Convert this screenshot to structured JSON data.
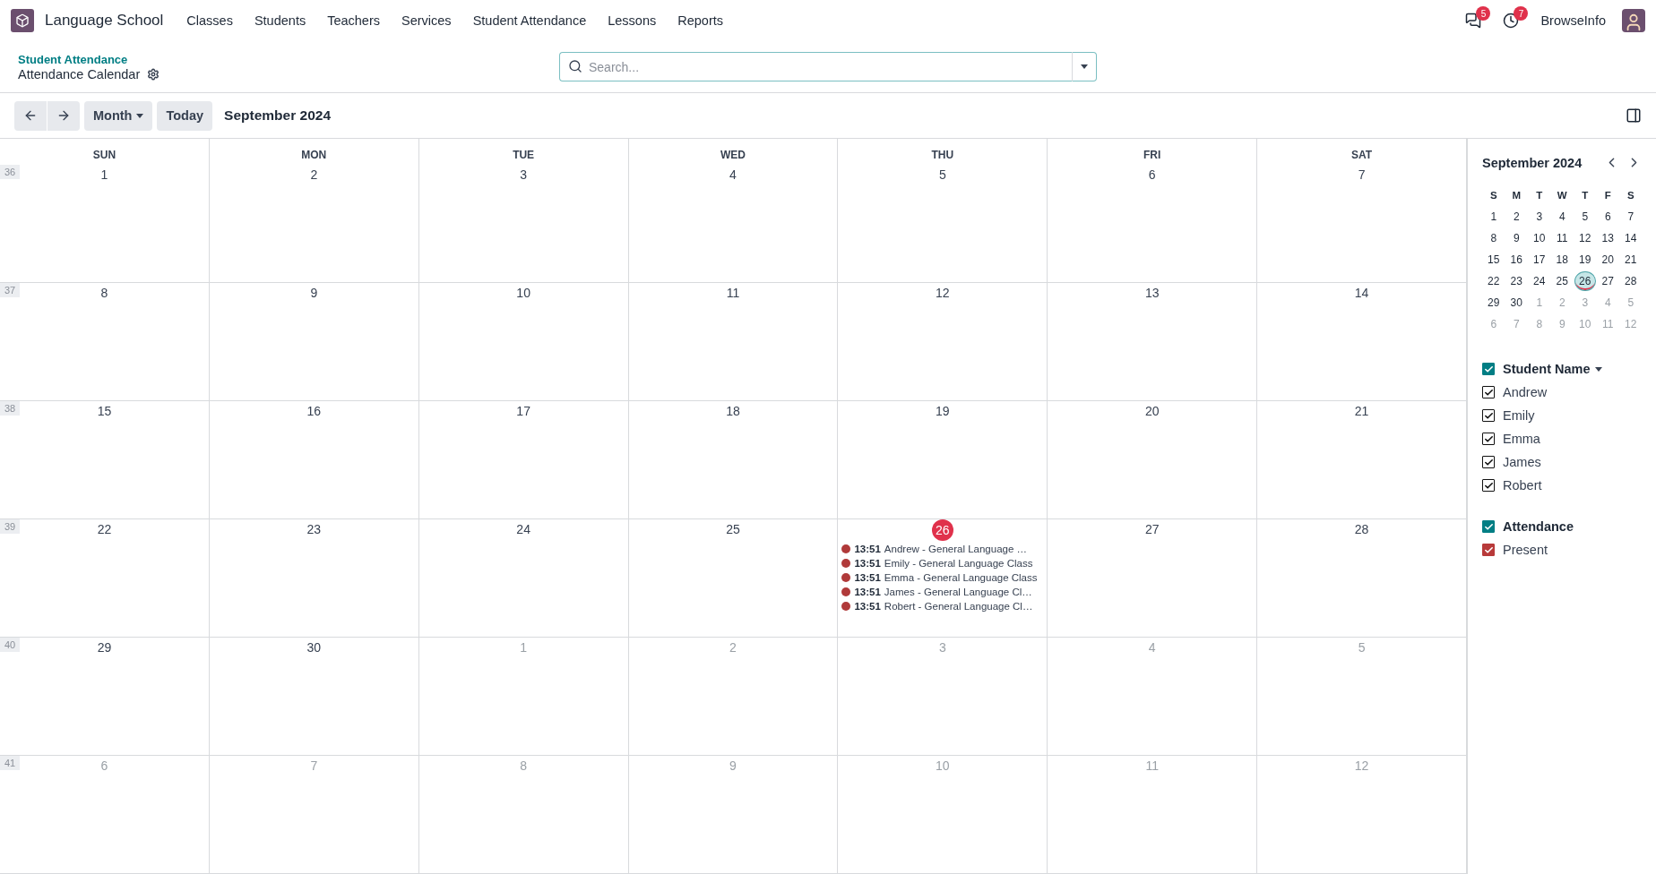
{
  "navbar": {
    "app_name": "Language School",
    "menu": [
      "Classes",
      "Students",
      "Teachers",
      "Services",
      "Student Attendance",
      "Lessons",
      "Reports"
    ],
    "messages_badge": "5",
    "activities_badge": "7",
    "user": "BrowseInfo"
  },
  "breadcrumb": {
    "parent": "Student Attendance",
    "current": "Attendance Calendar"
  },
  "search": {
    "placeholder": "Search..."
  },
  "toolbar": {
    "scale": "Month",
    "today": "Today",
    "period": "September 2024"
  },
  "calendar": {
    "weekdays": [
      "SUN",
      "MON",
      "TUE",
      "WED",
      "THU",
      "FRI",
      "SAT"
    ],
    "weeks": [
      {
        "number": "36",
        "days": [
          {
            "day": "1",
            "other_month": false,
            "today": false
          },
          {
            "day": "2",
            "other_month": false,
            "today": false
          },
          {
            "day": "3",
            "other_month": false,
            "today": false
          },
          {
            "day": "4",
            "other_month": false,
            "today": false
          },
          {
            "day": "5",
            "other_month": false,
            "today": false
          },
          {
            "day": "6",
            "other_month": false,
            "today": false
          },
          {
            "day": "7",
            "other_month": false,
            "today": false
          }
        ]
      },
      {
        "number": "37",
        "days": [
          {
            "day": "8",
            "other_month": false,
            "today": false
          },
          {
            "day": "9",
            "other_month": false,
            "today": false
          },
          {
            "day": "10",
            "other_month": false,
            "today": false
          },
          {
            "day": "11",
            "other_month": false,
            "today": false
          },
          {
            "day": "12",
            "other_month": false,
            "today": false
          },
          {
            "day": "13",
            "other_month": false,
            "today": false
          },
          {
            "day": "14",
            "other_month": false,
            "today": false
          }
        ]
      },
      {
        "number": "38",
        "days": [
          {
            "day": "15",
            "other_month": false,
            "today": false
          },
          {
            "day": "16",
            "other_month": false,
            "today": false
          },
          {
            "day": "17",
            "other_month": false,
            "today": false
          },
          {
            "day": "18",
            "other_month": false,
            "today": false
          },
          {
            "day": "19",
            "other_month": false,
            "today": false
          },
          {
            "day": "20",
            "other_month": false,
            "today": false
          },
          {
            "day": "21",
            "other_month": false,
            "today": false
          }
        ]
      },
      {
        "number": "39",
        "days": [
          {
            "day": "22",
            "other_month": false,
            "today": false
          },
          {
            "day": "23",
            "other_month": false,
            "today": false
          },
          {
            "day": "24",
            "other_month": false,
            "today": false
          },
          {
            "day": "25",
            "other_month": false,
            "today": false
          },
          {
            "day": "26",
            "other_month": false,
            "today": true,
            "events": [
              {
                "time": "13:51",
                "title": "Andrew - General Language …"
              },
              {
                "time": "13:51",
                "title": "Emily - General Language Class"
              },
              {
                "time": "13:51",
                "title": "Emma - General Language Class"
              },
              {
                "time": "13:51",
                "title": "James - General Language Cl…"
              },
              {
                "time": "13:51",
                "title": "Robert - General Language Cl…"
              }
            ]
          },
          {
            "day": "27",
            "other_month": false,
            "today": false
          },
          {
            "day": "28",
            "other_month": false,
            "today": false
          }
        ]
      },
      {
        "number": "40",
        "days": [
          {
            "day": "29",
            "other_month": false,
            "today": false
          },
          {
            "day": "30",
            "other_month": false,
            "today": false
          },
          {
            "day": "1",
            "other_month": true,
            "today": false
          },
          {
            "day": "2",
            "other_month": true,
            "today": false
          },
          {
            "day": "3",
            "other_month": true,
            "today": false
          },
          {
            "day": "4",
            "other_month": true,
            "today": false
          },
          {
            "day": "5",
            "other_month": true,
            "today": false
          }
        ]
      },
      {
        "number": "41",
        "days": [
          {
            "day": "6",
            "other_month": true,
            "today": false
          },
          {
            "day": "7",
            "other_month": true,
            "today": false
          },
          {
            "day": "8",
            "other_month": true,
            "today": false
          },
          {
            "day": "9",
            "other_month": true,
            "today": false
          },
          {
            "day": "10",
            "other_month": true,
            "today": false
          },
          {
            "day": "11",
            "other_month": true,
            "today": false
          },
          {
            "day": "12",
            "other_month": true,
            "today": false
          }
        ]
      }
    ]
  },
  "mini_calendar": {
    "title": "September 2024",
    "weekdays": [
      "S",
      "M",
      "T",
      "W",
      "T",
      "F",
      "S"
    ],
    "weeks": [
      [
        {
          "day": "1",
          "other_month": false,
          "today": false,
          "has_events": false
        },
        {
          "day": "2",
          "other_month": false,
          "today": false,
          "has_events": false
        },
        {
          "day": "3",
          "other_month": false,
          "today": false,
          "has_events": false
        },
        {
          "day": "4",
          "other_month": false,
          "today": false,
          "has_events": false
        },
        {
          "day": "5",
          "other_month": false,
          "today": false,
          "has_events": false
        },
        {
          "day": "6",
          "other_month": false,
          "today": false,
          "has_events": false
        },
        {
          "day": "7",
          "other_month": false,
          "today": false,
          "has_events": false
        }
      ],
      [
        {
          "day": "8",
          "other_month": false,
          "today": false,
          "has_events": false
        },
        {
          "day": "9",
          "other_month": false,
          "today": false,
          "has_events": false
        },
        {
          "day": "10",
          "other_month": false,
          "today": false,
          "has_events": false
        },
        {
          "day": "11",
          "other_month": false,
          "today": false,
          "has_events": false
        },
        {
          "day": "12",
          "other_month": false,
          "today": false,
          "has_events": false
        },
        {
          "day": "13",
          "other_month": false,
          "today": false,
          "has_events": false
        },
        {
          "day": "14",
          "other_month": false,
          "today": false,
          "has_events": false
        }
      ],
      [
        {
          "day": "15",
          "other_month": false,
          "today": false,
          "has_events": false
        },
        {
          "day": "16",
          "other_month": false,
          "today": false,
          "has_events": false
        },
        {
          "day": "17",
          "other_month": false,
          "today": false,
          "has_events": false
        },
        {
          "day": "18",
          "other_month": false,
          "today": false,
          "has_events": false
        },
        {
          "day": "19",
          "other_month": false,
          "today": false,
          "has_events": false
        },
        {
          "day": "20",
          "other_month": false,
          "today": false,
          "has_events": false
        },
        {
          "day": "21",
          "other_month": false,
          "today": false,
          "has_events": false
        }
      ],
      [
        {
          "day": "22",
          "other_month": false,
          "today": false,
          "has_events": false
        },
        {
          "day": "23",
          "other_month": false,
          "today": false,
          "has_events": false
        },
        {
          "day": "24",
          "other_month": false,
          "today": false,
          "has_events": false
        },
        {
          "day": "25",
          "other_month": false,
          "today": false,
          "has_events": false
        },
        {
          "day": "26",
          "other_month": false,
          "today": true,
          "has_events": true
        },
        {
          "day": "27",
          "other_month": false,
          "today": false,
          "has_events": false
        },
        {
          "day": "28",
          "other_month": false,
          "today": false,
          "has_events": false
        }
      ],
      [
        {
          "day": "29",
          "other_month": false,
          "today": false,
          "has_events": false
        },
        {
          "day": "30",
          "other_month": false,
          "today": false,
          "has_events": false
        },
        {
          "day": "1",
          "other_month": true,
          "today": false,
          "has_events": false
        },
        {
          "day": "2",
          "other_month": true,
          "today": false,
          "has_events": false
        },
        {
          "day": "3",
          "other_month": true,
          "today": false,
          "has_events": false
        },
        {
          "day": "4",
          "other_month": true,
          "today": false,
          "has_events": false
        },
        {
          "day": "5",
          "other_month": true,
          "today": false,
          "has_events": false
        }
      ],
      [
        {
          "day": "6",
          "other_month": true,
          "today": false,
          "has_events": false
        },
        {
          "day": "7",
          "other_month": true,
          "today": false,
          "has_events": false
        },
        {
          "day": "8",
          "other_month": true,
          "today": false,
          "has_events": false
        },
        {
          "day": "9",
          "other_month": true,
          "today": false,
          "has_events": false
        },
        {
          "day": "10",
          "other_month": true,
          "today": false,
          "has_events": false
        },
        {
          "day": "11",
          "other_month": true,
          "today": false,
          "has_events": false
        },
        {
          "day": "12",
          "other_month": true,
          "today": false,
          "has_events": false
        }
      ]
    ]
  },
  "filters": [
    {
      "title": "Student Name",
      "checked": true,
      "kind": "plain",
      "items": [
        {
          "label": "Andrew",
          "checked": true
        },
        {
          "label": "Emily",
          "checked": true
        },
        {
          "label": "Emma",
          "checked": true
        },
        {
          "label": "James",
          "checked": true
        },
        {
          "label": "Robert",
          "checked": true
        }
      ]
    },
    {
      "title": "Attendance",
      "checked": true,
      "kind": "colored",
      "items": [
        {
          "label": "Present",
          "checked": true
        }
      ]
    }
  ]
}
